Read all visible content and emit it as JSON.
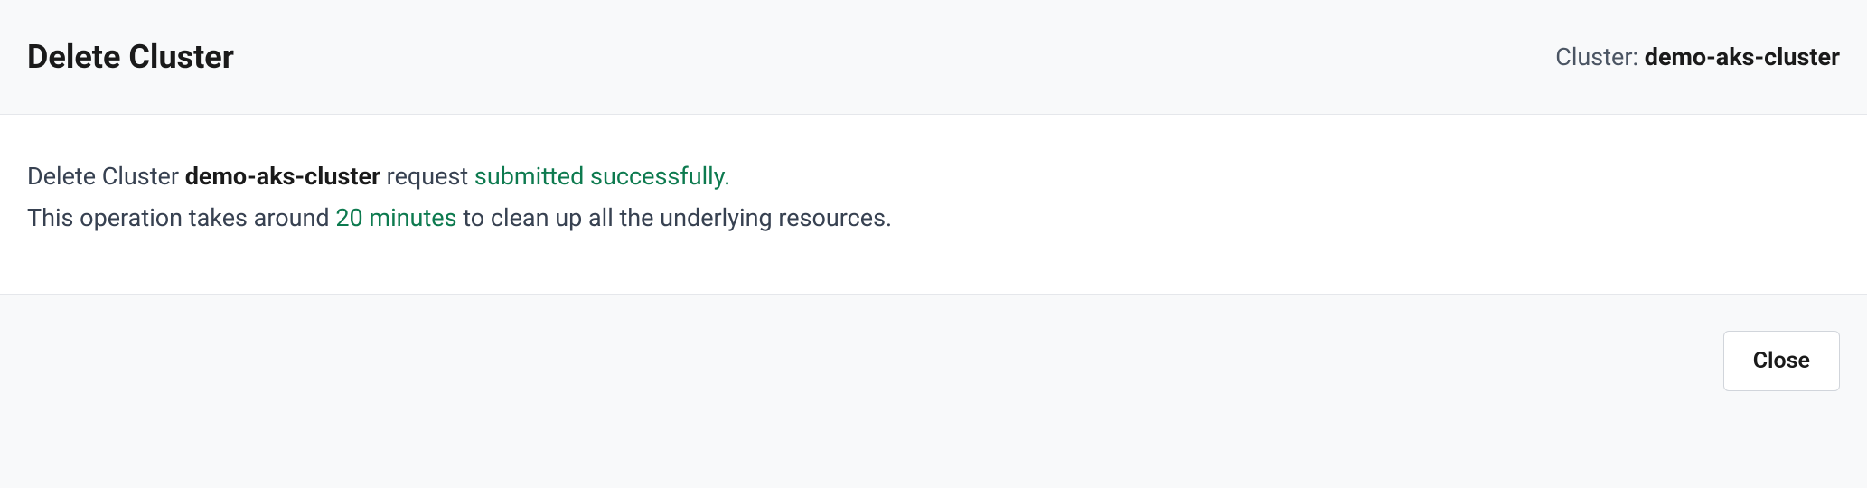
{
  "header": {
    "title": "Delete Cluster",
    "cluster_label": "Cluster: ",
    "cluster_name": "demo-aks-cluster"
  },
  "content": {
    "line1_prefix": "Delete Cluster ",
    "line1_cluster_name": "demo-aks-cluster",
    "line1_mid": " request ",
    "line1_success": "submitted successfully.",
    "line2_prefix": "This operation takes around ",
    "line2_duration": "20 minutes",
    "line2_suffix": " to clean up all the underlying resources."
  },
  "footer": {
    "close_label": "Close"
  }
}
